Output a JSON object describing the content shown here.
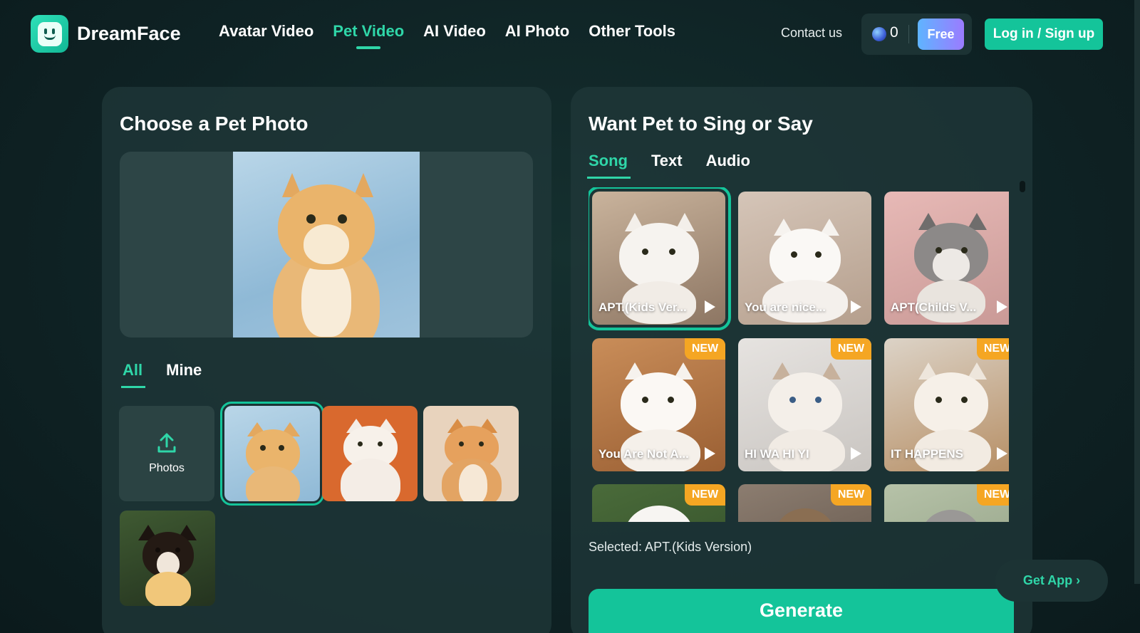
{
  "header": {
    "logo_text": "DreamFace",
    "nav": [
      "Avatar Video",
      "Pet Video",
      "AI Video",
      "AI Photo",
      "Other Tools"
    ],
    "active_nav": "Pet Video",
    "contact": "Contact us",
    "credits": "0",
    "free_label": "Free",
    "login_label": "Log in / Sign up"
  },
  "left": {
    "title": "Choose a Pet Photo",
    "tabs": [
      "All",
      "Mine"
    ],
    "upload_label": "Photos"
  },
  "right": {
    "title": "Want Pet to Sing or Say",
    "tabs": [
      "Song",
      "Text",
      "Audio"
    ],
    "songs": [
      {
        "label": "APT.(Kids Ver...",
        "new": false
      },
      {
        "label": "You are nice...",
        "new": false
      },
      {
        "label": "APT(Childs V...",
        "new": false
      },
      {
        "label": "You Are Not A...",
        "new": true
      },
      {
        "label": "HI WA HI YI",
        "new": true
      },
      {
        "label": "IT HAPPENS",
        "new": true
      },
      {
        "label": "",
        "new": true
      },
      {
        "label": "",
        "new": true
      },
      {
        "label": "",
        "new": true
      }
    ],
    "new_badge": "NEW",
    "selected_text": "Selected: APT.(Kids Version)",
    "generate_label": "Generate"
  },
  "get_app": "Get App ›",
  "colors": {
    "accent": "#14c49a",
    "new_badge": "#f5a623",
    "background": "#0f2325"
  }
}
